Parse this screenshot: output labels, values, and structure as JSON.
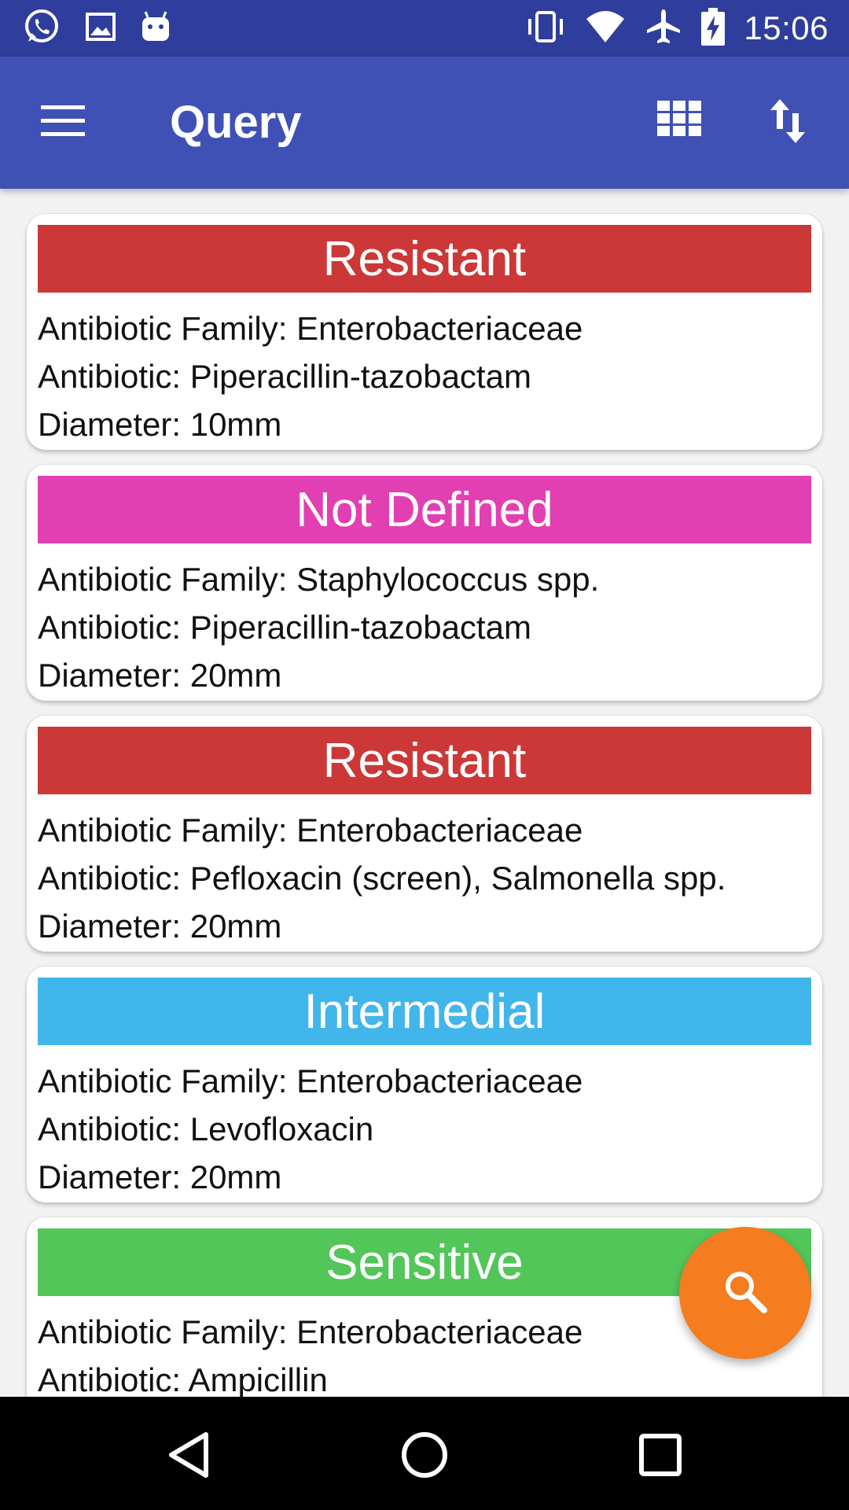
{
  "status_bar": {
    "time": "15:06",
    "left_icons": [
      "whatsapp-icon",
      "gallery-icon",
      "android-debug-icon"
    ],
    "right_icons": [
      "vibrate-icon",
      "wifi-icon",
      "airplane-icon",
      "battery-charging-icon"
    ]
  },
  "app_bar": {
    "title": "Query",
    "menu_icon": "hamburger-menu-icon",
    "grid_icon": "grid-view-icon",
    "sort_icon": "sort-icon"
  },
  "cards": [
    {
      "status": "Resistant",
      "status_color": "#cc3838",
      "family": "Antibiotic Family: Enterobacteriaceae",
      "antibiotic": "Antibiotic: Piperacillin-tazobactam",
      "diameter": "Diameter: 10mm"
    },
    {
      "status": "Not Defined",
      "status_color": "#e23fb2",
      "family": "Antibiotic Family: Staphylococcus spp.",
      "antibiotic": "Antibiotic: Piperacillin-tazobactam",
      "diameter": "Diameter: 20mm"
    },
    {
      "status": "Resistant",
      "status_color": "#cc3838",
      "family": "Antibiotic Family: Enterobacteriaceae",
      "antibiotic": "Antibiotic: Pefloxacin (screen), Salmonella spp.",
      "diameter": "Diameter: 20mm"
    },
    {
      "status": "Intermedial",
      "status_color": "#41b6ea",
      "family": "Antibiotic Family: Enterobacteriaceae",
      "antibiotic": "Antibiotic: Levofloxacin",
      "diameter": "Diameter: 20mm"
    },
    {
      "status": "Sensitive",
      "status_color": "#53c65a",
      "family": "Antibiotic Family: Enterobacteriaceae",
      "antibiotic": "Antibiotic: Ampicillin",
      "diameter": ""
    }
  ],
  "fab": {
    "icon": "search-icon",
    "color": "#f57c1f"
  },
  "nav_bar": {
    "icons": [
      "back-icon",
      "home-icon",
      "recents-icon"
    ]
  }
}
